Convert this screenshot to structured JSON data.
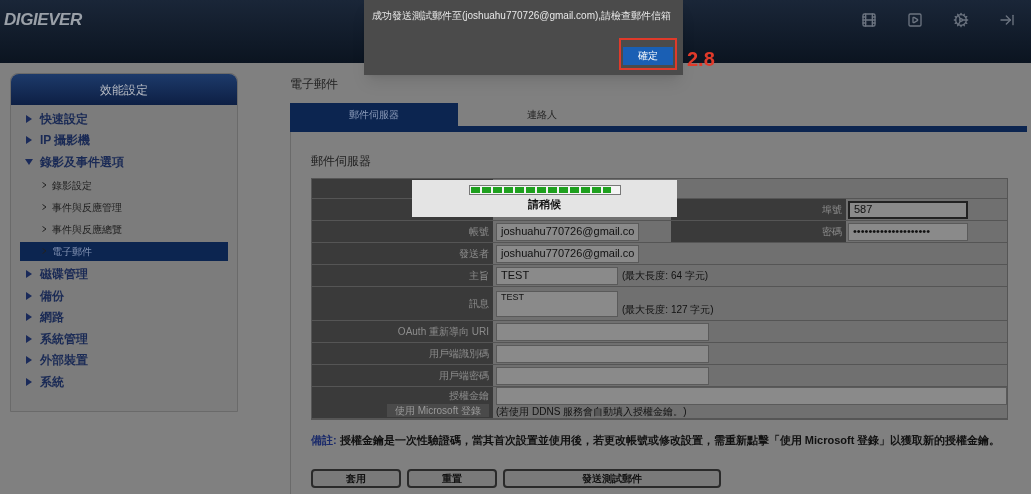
{
  "header": {
    "logo": "DIGIEVER"
  },
  "dialog": {
    "message": "成功發送測試郵件至(joshuahu770726@gmail.com),請檢查郵件信箱",
    "ok_button": "確定",
    "annotation": "2.8"
  },
  "sidebar": {
    "title": "效能設定",
    "items": [
      {
        "label": "快速設定",
        "expanded": false
      },
      {
        "label": "IP 攝影機",
        "expanded": false
      },
      {
        "label": "錄影及事件選項",
        "expanded": true,
        "children": [
          {
            "label": "錄影設定",
            "selected": false
          },
          {
            "label": "事件與反應管理",
            "selected": false
          },
          {
            "label": "事件與反應總覽",
            "selected": false
          },
          {
            "label": "電子郵件",
            "selected": true
          }
        ]
      },
      {
        "label": "磁碟管理",
        "expanded": false
      },
      {
        "label": "備份",
        "expanded": false
      },
      {
        "label": "網路",
        "expanded": false
      },
      {
        "label": "系統管理",
        "expanded": false
      },
      {
        "label": "外部裝置",
        "expanded": false
      },
      {
        "label": "系統",
        "expanded": false
      }
    ]
  },
  "page_title": "電子郵件",
  "tabs": [
    {
      "label": "郵件伺服器",
      "selected": true
    },
    {
      "label": "連絡人",
      "selected": false
    }
  ],
  "section_title": "郵件伺服器",
  "rows": [
    {
      "kind": "blank"
    },
    {
      "kind": "pair",
      "right_label": "埠號",
      "right_value": "587",
      "right_focused": true
    },
    {
      "kind": "pair",
      "label": "帳號",
      "value": "joshuahu770726@gmail.co",
      "right_label": "密碼",
      "right_value": "••••••••••••••••••••",
      "right_focused": false
    },
    {
      "kind": "field",
      "label": "發送者",
      "value": "joshuahu770726@gmail.co"
    },
    {
      "kind": "field",
      "label": "主旨",
      "value": "TEST",
      "hint": "(最大長度: 64 字元)"
    },
    {
      "kind": "textarea",
      "label": "訊息",
      "value": "TEST",
      "hint": "(最大長度: 127 字元)"
    },
    {
      "kind": "wide",
      "label": "OAuth 重新導向 URI"
    },
    {
      "kind": "wide",
      "label": "用戶端識別碼"
    },
    {
      "kind": "wide",
      "label": "用戶端密碼"
    },
    {
      "kind": "key",
      "label": "授權金鑰",
      "button": "使用 Microsoft 登錄",
      "hint": "(若使用 DDNS 服務會自動填入授權金鑰。)"
    }
  ],
  "progress": {
    "level": 0.95,
    "text": "請稍候"
  },
  "note": {
    "label": "備註:",
    "text": "授權金鑰是一次性驗證碼，當其首次設置並使用後，若更改帳號或修改設置，需重新點擊「使用 Microsoft 登錄」以獲取新的授權金鑰。"
  },
  "buttons": [
    "套用",
    "重置",
    "發送測試郵件"
  ]
}
